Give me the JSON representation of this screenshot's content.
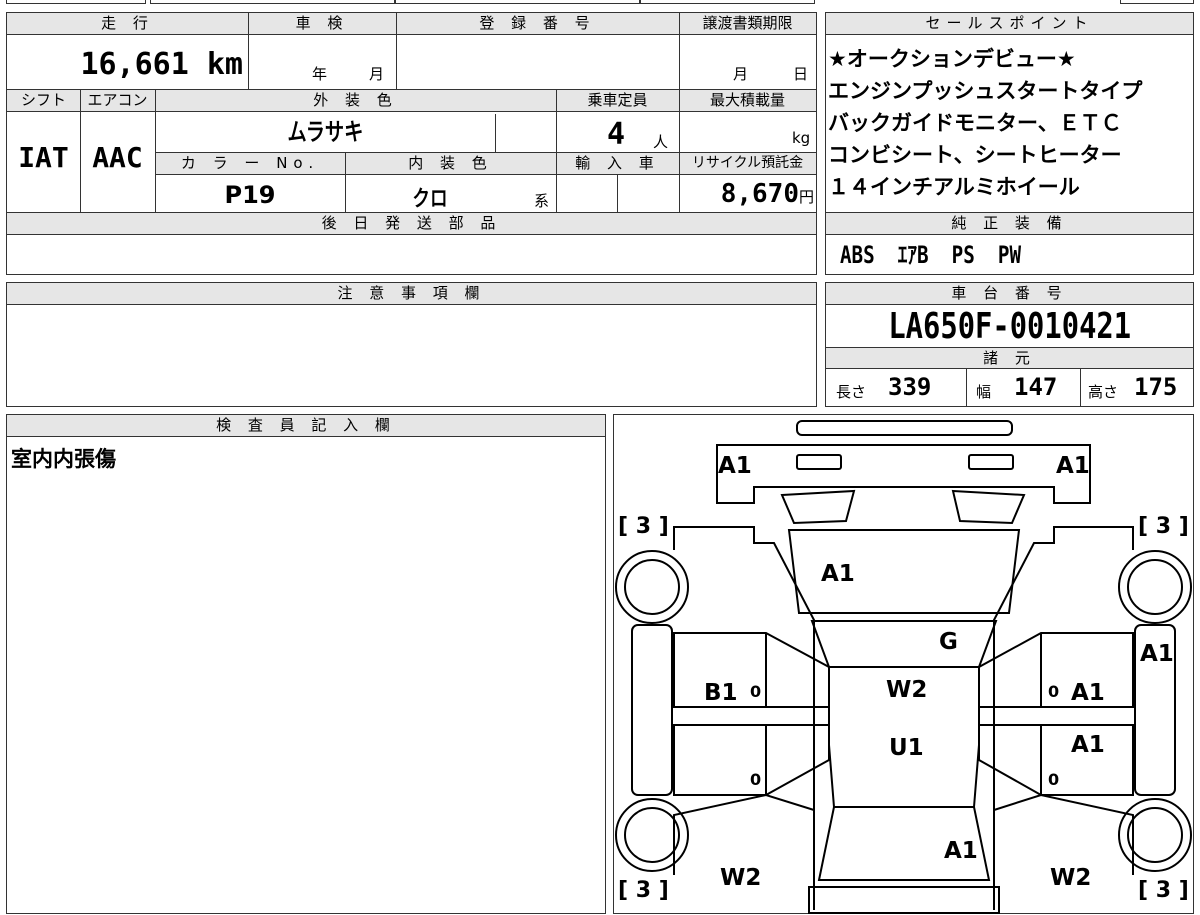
{
  "mileage": {
    "header": "走 行",
    "value": "16,661",
    "unit": "km"
  },
  "inspection": {
    "header": "車 検",
    "year_label": "年",
    "month_label": "月"
  },
  "registration": {
    "header": "登 録 番 号",
    "value": ""
  },
  "transfer_deadline": {
    "header": "譲渡書類期限",
    "month_label": "月",
    "day_label": "日"
  },
  "sales_points": {
    "header": "セールスポイント",
    "lines": [
      "★オークションデビュー★",
      "エンジンプッシュスタートタイプ",
      "バックガイドモニター、ＥＴＣ",
      "コンビシート、シートヒーター",
      "１４インチアルミホイール"
    ]
  },
  "shift": {
    "header": "シフト",
    "value": "IAT"
  },
  "aircon": {
    "header": "エアコン",
    "value": "AAC"
  },
  "exterior_color": {
    "header": "外 装 色",
    "value": "ムラサキ"
  },
  "capacity": {
    "header": "乗車定員",
    "value": "4",
    "unit": "人"
  },
  "max_load": {
    "header": "最大積載量",
    "value": "",
    "unit": "kg"
  },
  "color_no": {
    "header": "カ ラ ー No.",
    "value": "P19"
  },
  "interior_color": {
    "header": "内 装 色",
    "value": "クロ",
    "suffix": "系"
  },
  "import": {
    "header": "輸 入 車",
    "value": ""
  },
  "recycle_fee": {
    "header": "リサイクル預託金",
    "value": "8,670",
    "unit": "円"
  },
  "later_parts": {
    "header": "後 日 発 送 部 品",
    "value": ""
  },
  "genuine_equipment": {
    "header": "純 正 装 備",
    "value": "ABS  ｴｱB  PS  PW"
  },
  "notes": {
    "header": "注 意 事 項 欄",
    "value": ""
  },
  "chassis_number": {
    "header": "車 台 番 号",
    "value": "LA650F-0010421"
  },
  "specs": {
    "header": "諸 元",
    "length_label": "長さ",
    "length": "339",
    "width_label": "幅",
    "width": "147",
    "height_label": "高さ",
    "height": "175"
  },
  "inspector": {
    "header": "検 査 員 記 入 欄",
    "value": "室内内張傷"
  },
  "diagram": {
    "marks": {
      "front_bumper_left": "A1",
      "front_bumper_right": "A1",
      "hood": "A1",
      "windshield": "G",
      "roof_front": "W2",
      "roof_rear": "U1",
      "left_front_door": "B1",
      "right_front_door": "A1",
      "right_rear_door": "A1",
      "right_front_fender": "A1",
      "rear_gate": "A1",
      "left_rear_quarter": "W2",
      "right_rear_quarter": "W2",
      "tire_front_left": "3",
      "tire_front_right": "3",
      "tire_rear_left": "3",
      "tire_rear_right": "3",
      "door_marks": [
        "0",
        "0",
        "0",
        "0"
      ]
    }
  }
}
